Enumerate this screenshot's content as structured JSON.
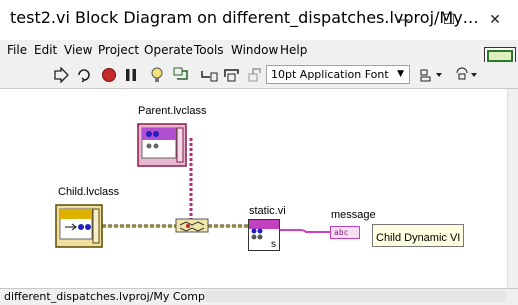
{
  "window": {
    "title": "test2.vi Block Diagram on different_dispatches.lvproj/My…",
    "minimize_glyph": "—",
    "maximize_glyph": "☐",
    "close_glyph": "✕"
  },
  "menu": [
    "File",
    "Edit",
    "View",
    "Project",
    "Operate",
    "Tools",
    "Window",
    "Help"
  ],
  "toolbar": {
    "font_select_value": "10pt Application Font",
    "icons": [
      "run-arrow-icon",
      "run-continuously-icon",
      "abort-icon",
      "pause-icon",
      "highlight-execution-icon",
      "retain-wire-values-icon",
      "step-into-icon",
      "step-over-icon",
      "step-out-icon",
      "align-objects-icon",
      "reorder-icon"
    ]
  },
  "diagram": {
    "parent_class_label": "Parent.lvclass",
    "child_class_label": "Child.lvclass",
    "static_vi_label": "static.vi",
    "static_vi_terminal": "s",
    "message_label": "message",
    "message_indicator_text": "abc",
    "message_value": "Child Dynamic VI",
    "colors": {
      "class_wire": "#b03070",
      "object_wire": "#5a4a00",
      "string_wire": "#d040c0"
    }
  },
  "status": {
    "path": "different_dispatches.lvproj/My Computer"
  }
}
